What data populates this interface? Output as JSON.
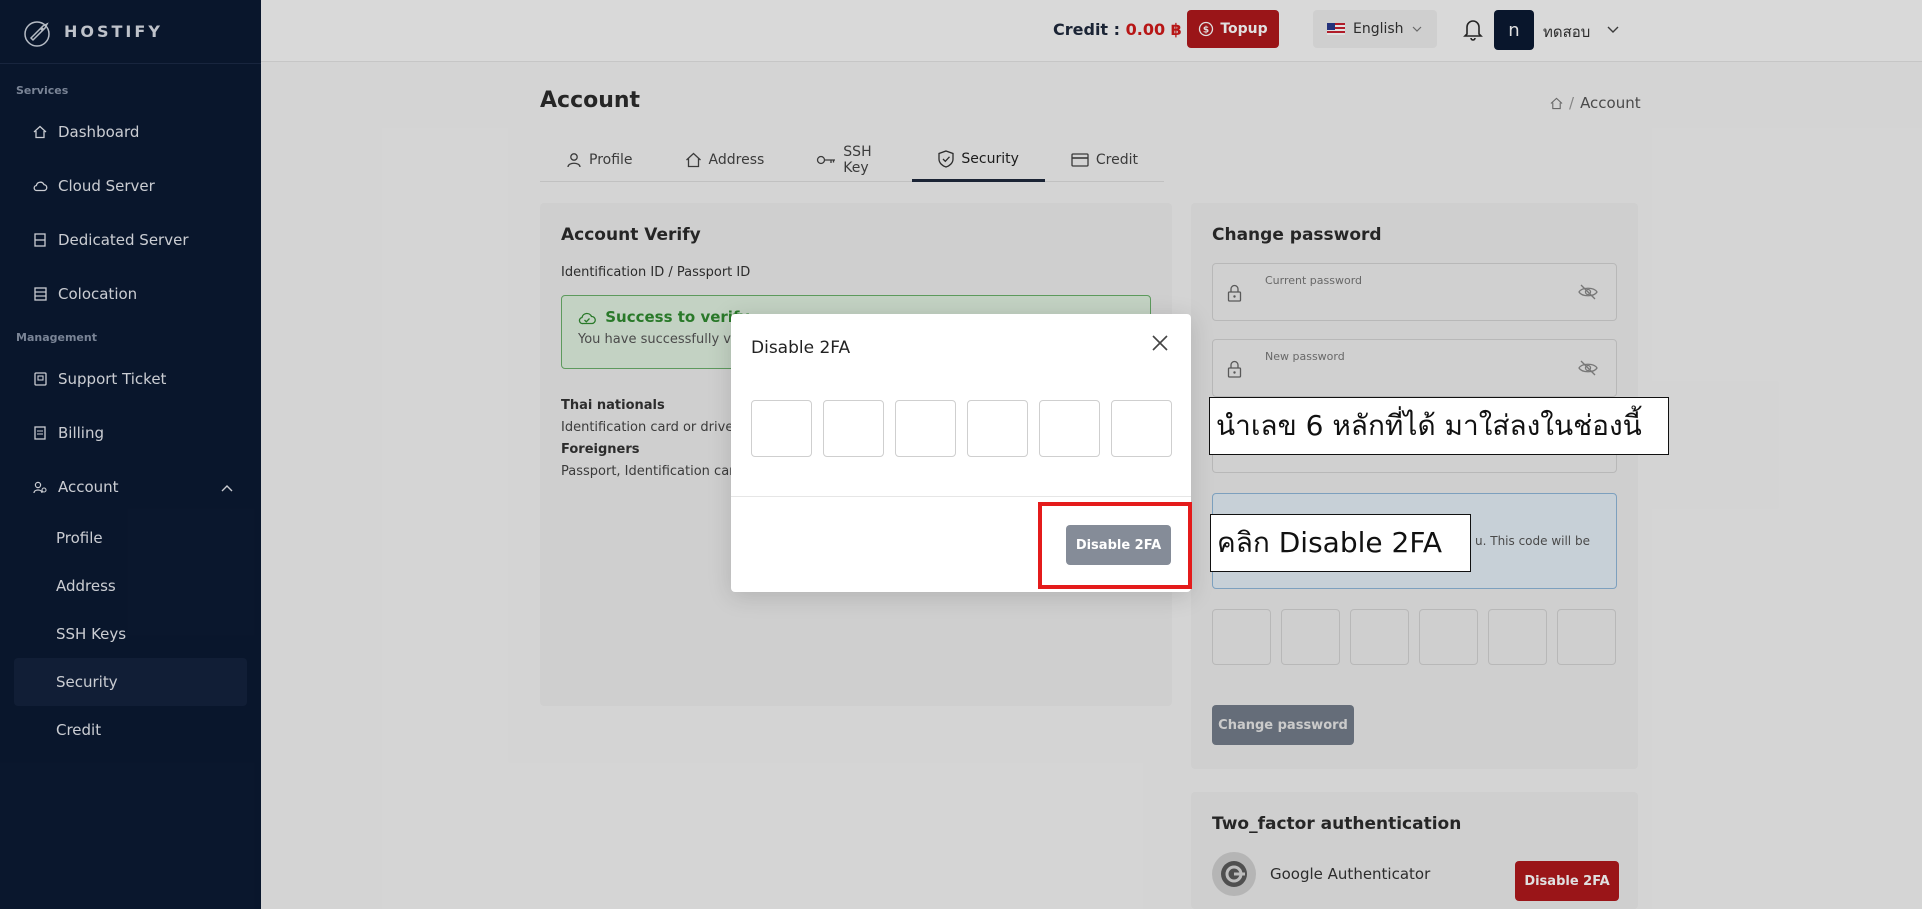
{
  "brand": {
    "name": "HOSTIFY"
  },
  "sidebar": {
    "sections": {
      "services": "Services",
      "management": "Management"
    },
    "services_items": [
      {
        "label": "Dashboard",
        "icon": "home-icon"
      },
      {
        "label": "Cloud Server",
        "icon": "cloud-icon"
      },
      {
        "label": "Dedicated Server",
        "icon": "server-icon"
      },
      {
        "label": "Colocation",
        "icon": "rack-icon"
      }
    ],
    "management_items": [
      {
        "label": "Support Ticket",
        "icon": "ticket-icon"
      },
      {
        "label": "Billing",
        "icon": "billing-icon"
      },
      {
        "label": "Account",
        "icon": "users-icon"
      }
    ],
    "account_sub": [
      "Profile",
      "Address",
      "SSH Keys",
      "Security",
      "Credit"
    ],
    "active_sub": "Security"
  },
  "topbar": {
    "credit_label": "Credit : ",
    "credit_amount": "0.00 ฿",
    "topup_label": "Topup",
    "language": "English",
    "avatar_letter": "n",
    "username": "ทดสอบ"
  },
  "page": {
    "title": "Account",
    "breadcrumb_current": "Account",
    "breadcrumb_sep": "/",
    "tabs": [
      "Profile",
      "Address",
      "SSH Key",
      "Security",
      "Credit"
    ],
    "active_tab": "Security"
  },
  "verify": {
    "title": "Account Verify",
    "id_label": "Identification ID / Passport ID",
    "success_title": "Success to verify",
    "success_desc": "You have successfully ver",
    "thai_title": "Thai nationals",
    "thai_desc": "Identification card or driver's",
    "foreign_title": "Foreigners",
    "foreign_desc": "Passport, Identification card"
  },
  "password": {
    "title": "Change password",
    "current_ph": "Current password",
    "new_ph": "New password",
    "info_text": "u. This code will be",
    "button": "Change password"
  },
  "tfa": {
    "title": "Two_factor authentication",
    "app_name": "Google Authenticator",
    "button": "Disable 2FA"
  },
  "modal": {
    "title": "Disable 2FA",
    "button": "Disable 2FA"
  },
  "annotations": {
    "callout_1": "นำเลข 6 หลักที่ได้ มาใส่ลงในช่องนี้",
    "callout_2": "คลิก Disable 2FA",
    "highlight_color": "#e41b1b"
  },
  "colors": {
    "sidebar_bg": "#0b1a33",
    "accent_red": "#b0181c",
    "success_green": "#2f8a2f"
  }
}
